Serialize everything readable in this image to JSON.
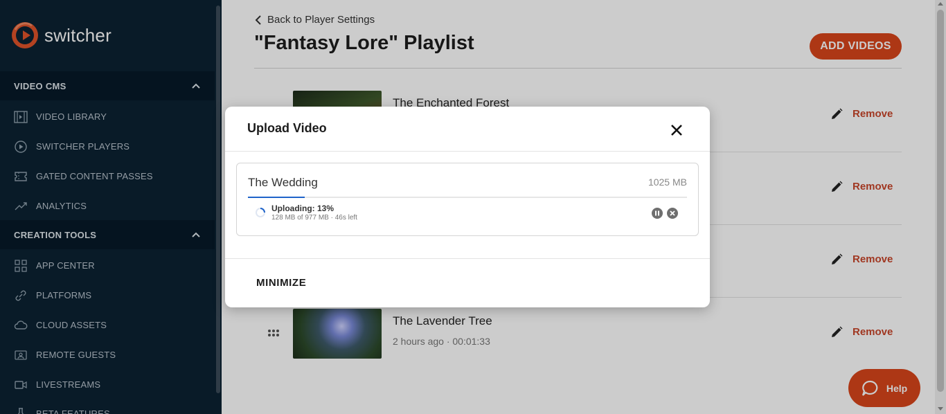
{
  "app": {
    "logo_text": "switcher",
    "brand_color": "#d9451b"
  },
  "sidebar": {
    "sections": [
      {
        "label": "VIDEO CMS",
        "items": [
          {
            "label": "VIDEO LIBRARY",
            "icon": "film-icon"
          },
          {
            "label": "SWITCHER PLAYERS",
            "icon": "player-icon"
          },
          {
            "label": "GATED CONTENT PASSES",
            "icon": "ticket-icon"
          },
          {
            "label": "ANALYTICS",
            "icon": "trend-icon"
          }
        ]
      },
      {
        "label": "CREATION TOOLS",
        "items": [
          {
            "label": "APP CENTER",
            "icon": "grid-icon"
          },
          {
            "label": "PLATFORMS",
            "icon": "link-icon"
          },
          {
            "label": "CLOUD ASSETS",
            "icon": "cloud-icon"
          },
          {
            "label": "REMOTE GUESTS",
            "icon": "guests-icon"
          },
          {
            "label": "LIVESTREAMS",
            "icon": "camera-icon"
          },
          {
            "label": "BETA FEATURES",
            "icon": "flask-icon"
          }
        ]
      }
    ]
  },
  "main": {
    "back_label": "Back to Player Settings",
    "page_title": "\"Fantasy Lore\" Playlist",
    "add_button": "ADD VIDEOS",
    "remove_label": "Remove",
    "videos": [
      {
        "title": "The Enchanted Forest",
        "meta": ""
      },
      {
        "title": "",
        "meta": ""
      },
      {
        "title": "",
        "meta": ""
      },
      {
        "title": "The Lavender Tree",
        "meta": "2 hours ago  ·  00:01:33"
      }
    ],
    "help_label": "Help"
  },
  "modal": {
    "title": "Upload Video",
    "file_name": "The Wedding",
    "file_size": "1025 MB",
    "progress_fraction": 0.13,
    "status_line1": "Uploading: 13%",
    "status_line2": "128 MB of 977 MB · 46s left",
    "minimize_label": "MINIMIZE"
  }
}
